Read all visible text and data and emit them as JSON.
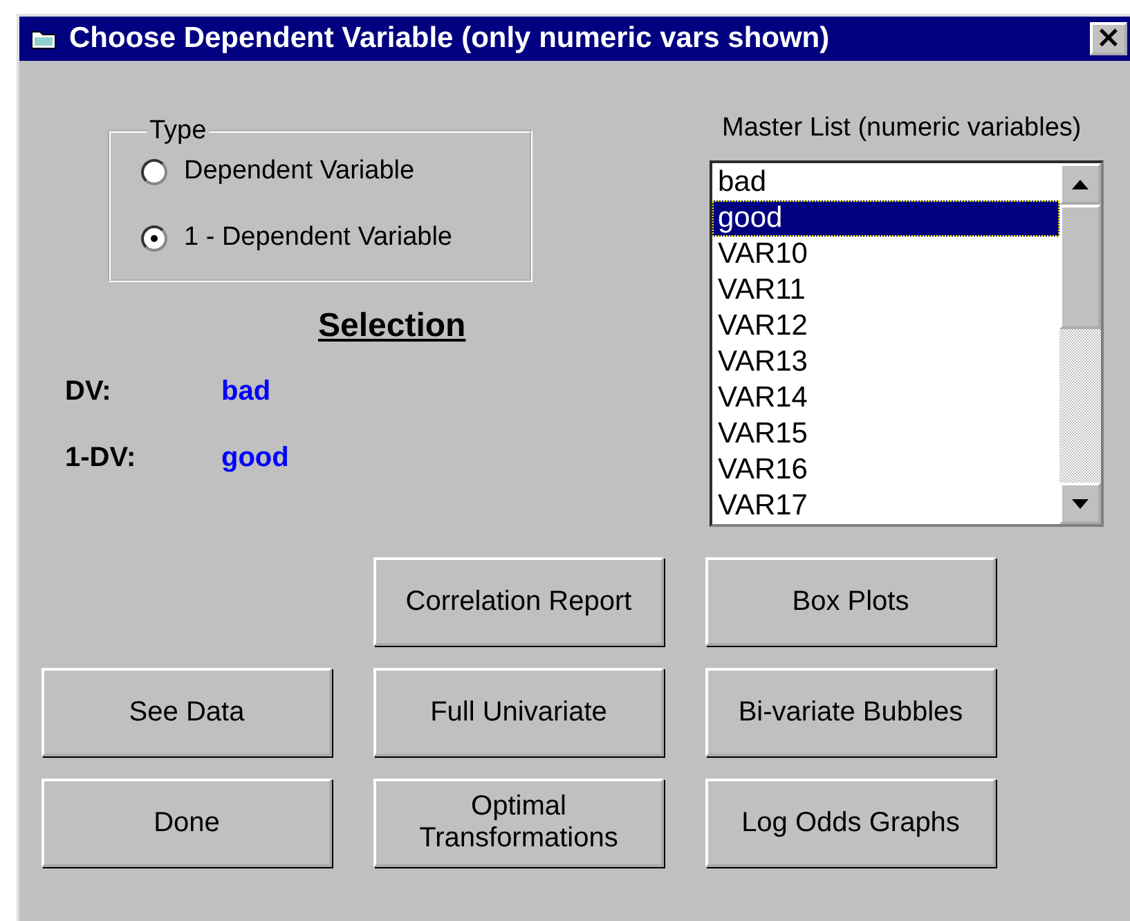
{
  "window": {
    "title": "Choose Dependent Variable (only numeric vars shown)",
    "close": "×"
  },
  "type_group": {
    "label": "Type",
    "options": [
      {
        "label": "Dependent Variable",
        "selected": false
      },
      {
        "label": "1 - Dependent Variable",
        "selected": true
      }
    ]
  },
  "selection": {
    "heading": "Selection",
    "rows": [
      {
        "label": "DV:",
        "value": "bad"
      },
      {
        "label": "1-DV:",
        "value": "good"
      }
    ]
  },
  "master_list": {
    "label": "Master List (numeric variables)",
    "items": [
      {
        "label": "bad",
        "selected": false
      },
      {
        "label": "good",
        "selected": true
      },
      {
        "label": "VAR10",
        "selected": false
      },
      {
        "label": "VAR11",
        "selected": false
      },
      {
        "label": "VAR12",
        "selected": false
      },
      {
        "label": "VAR13",
        "selected": false
      },
      {
        "label": "VAR14",
        "selected": false
      },
      {
        "label": "VAR15",
        "selected": false
      },
      {
        "label": "VAR16",
        "selected": false
      },
      {
        "label": "VAR17",
        "selected": false
      }
    ]
  },
  "buttons": [
    {
      "label": "Correlation Report"
    },
    {
      "label": "Box Plots"
    },
    {
      "label": "See Data"
    },
    {
      "label": "Full Univariate"
    },
    {
      "label": "Bi-variate Bubbles"
    },
    {
      "label": "Done"
    },
    {
      "label": "Optimal Transformations"
    },
    {
      "label": "Log Odds Graphs"
    }
  ]
}
